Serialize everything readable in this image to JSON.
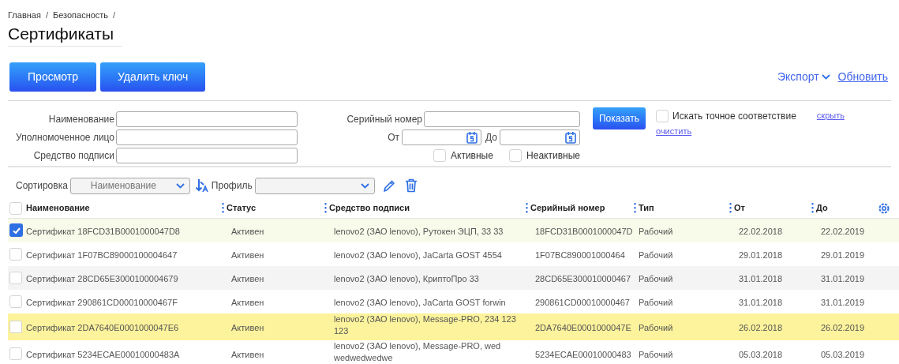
{
  "breadcrumb": {
    "items": [
      "Главная",
      "Безопасность"
    ],
    "separator": "/"
  },
  "title": "Сертификаты",
  "actions": [
    "Просмотр",
    "Удалить ключ"
  ],
  "export": "Экспорт",
  "refresh": "Обновить",
  "filters": {
    "fields": [
      {
        "label": "Наименование"
      },
      {
        "label": "Уполномоченное лицо"
      },
      {
        "label": "Средство подписи"
      }
    ],
    "serial": {
      "label": "Серийный номер"
    },
    "from": {
      "label": "От"
    },
    "to": {
      "label": "До"
    },
    "active": {
      "label": "Активные",
      "checked": false
    },
    "inactive": {
      "label": "Неактивные",
      "checked": false
    },
    "show_button": "Показать",
    "exact": {
      "label": "Искать точное соответствие",
      "checked": false
    },
    "hide_link": "скрыть",
    "clear_link": "очистить"
  },
  "sort": {
    "label": "Сортировка",
    "value": "Наименование"
  },
  "profile": {
    "label": "Профиль"
  },
  "table": {
    "all_checked": false,
    "columns": [
      "Наименование",
      "Статус",
      "Средство подписи",
      "Серийный номер",
      "Тип",
      "От",
      "До"
    ],
    "rows": [
      {
        "checked": true,
        "highlighted": false,
        "cells": [
          "Сертификат 18FCD31B0001000047D8",
          "Активен",
          "lenovo2 (ЗАО lenovo), Рутокен ЭЦП, 33 33",
          "18FCD31B0001000047D",
          "Рабочий",
          "22.02.2018",
          "22.02.2019"
        ]
      },
      {
        "checked": false,
        "highlighted": false,
        "cells": [
          "Сертификат 1F07BC89000100004647",
          "Активен",
          "lenovo2 (ЗАО lenovo), JaCarta GOST 4554",
          "1F07BC890001000464",
          "Рабочий",
          "29.01.2018",
          "29.01.2019"
        ]
      },
      {
        "checked": false,
        "highlighted": false,
        "cells": [
          "Сертификат 28CD65E3000100004679",
          "Активен",
          "lenovo2 (ЗАО lenovo), КриптоПро 33",
          "28CD65E300010000467",
          "Рабочий",
          "31.01.2018",
          "31.01.2019"
        ]
      },
      {
        "checked": false,
        "highlighted": false,
        "cells": [
          "Сертификат 290861CD00010000467F",
          "Активен",
          "lenovo2 (ЗАО lenovo), JaCarta GOST forwin",
          "290861CD00010000467",
          "Рабочий",
          "31.01.2018",
          "31.01.2019"
        ]
      },
      {
        "checked": false,
        "highlighted": true,
        "cells": [
          "Сертификат 2DA7640E0001000047E6",
          "Активен",
          "lenovo2 (ЗАО lenovo), Message-PRO, 234 123 123",
          "2DA7640E0001000047E",
          "Рабочий",
          "26.02.2018",
          "26.02.2019"
        ]
      },
      {
        "checked": false,
        "highlighted": false,
        "cells": [
          "Сертификат 5234ECAE00010000483A",
          "Активен",
          "lenovo2 (ЗАО lenovo), Message-PRO, wed wedwedwedwe",
          "5234ECAE00010000483",
          "Рабочий",
          "05.03.2018",
          "05.03.2019"
        ]
      }
    ]
  }
}
